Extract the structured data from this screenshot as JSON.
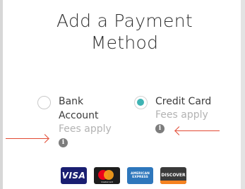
{
  "title": "Add a Payment Method",
  "options": [
    {
      "label_line1": "Bank",
      "label_line2": "Account",
      "fees": "Fees apply",
      "selected": false,
      "info_glyph": "i"
    },
    {
      "label_line1": "Credit Card",
      "fees": "Fees apply",
      "selected": true,
      "info_glyph": "i"
    }
  ],
  "colors": {
    "radio_selected": "#3fb3b3",
    "arrow": "#e24a33",
    "fees_text": "#b3b3b3"
  },
  "icons": [
    "info-icon",
    "info-icon"
  ],
  "card_logos": {
    "visa": "VISA",
    "mastercard": "mastercard",
    "amex_line1": "AMERICAN",
    "amex_line2": "EXPRESS",
    "discover": "DISCOVER"
  }
}
